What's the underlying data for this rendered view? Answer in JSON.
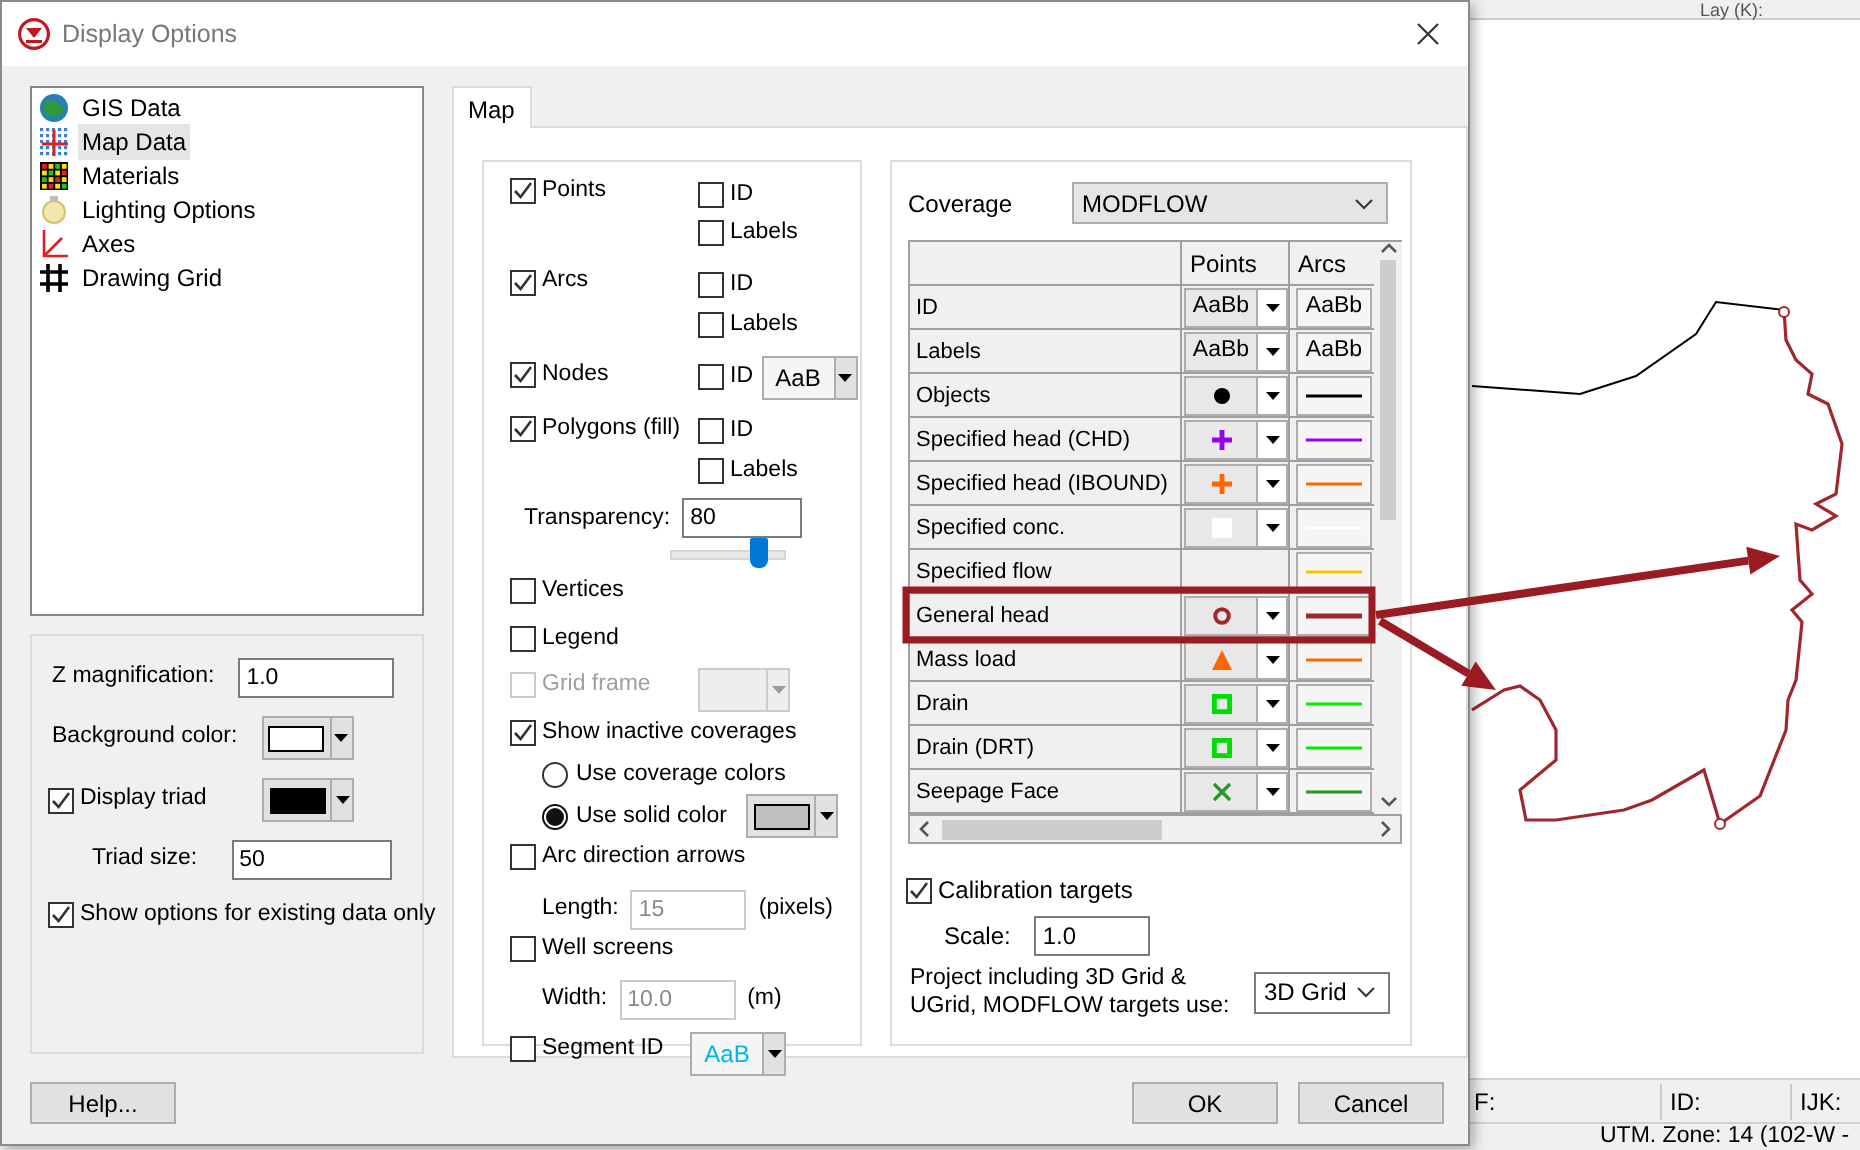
{
  "window": {
    "title": "Display Options"
  },
  "toolbar": {
    "layer_label": "Lay (K):"
  },
  "tree": [
    {
      "label": "GIS Data",
      "kind": "globe",
      "selected": false
    },
    {
      "label": "Map Data",
      "kind": "dots",
      "selected": true
    },
    {
      "label": "Materials",
      "kind": "cells",
      "selected": false
    },
    {
      "label": "Lighting Options",
      "kind": "bulb",
      "selected": false
    },
    {
      "label": "Axes",
      "kind": "axes",
      "selected": false
    },
    {
      "label": "Drawing Grid",
      "kind": "grid",
      "selected": false
    }
  ],
  "display": {
    "z_magnification": {
      "label": "Z magnification:",
      "value": "1.0"
    },
    "background_color": {
      "label": "Background color:",
      "color": "#ffffff"
    },
    "display_triad": {
      "label": "Display triad",
      "checked": true,
      "color": "#000000"
    },
    "triad_size": {
      "label": "Triad size:",
      "value": "50"
    },
    "existing_data_only": {
      "label": "Show options for existing data only",
      "checked": true
    }
  },
  "tabs": [
    {
      "label": "Map",
      "selected": true
    }
  ],
  "map_options": {
    "points": {
      "label": "Points",
      "checked": true,
      "id": {
        "label": "ID",
        "checked": false
      },
      "labels": {
        "label": "Labels",
        "checked": false
      }
    },
    "arcs": {
      "label": "Arcs",
      "checked": true,
      "id": {
        "label": "ID",
        "checked": false
      },
      "labels": {
        "label": "Labels",
        "checked": false
      }
    },
    "nodes": {
      "label": "Nodes",
      "checked": true,
      "id": {
        "label": "ID",
        "checked": false
      },
      "font_sample": "AaB",
      "color": "#000000"
    },
    "polygons": {
      "label": "Polygons (fill)",
      "checked": true,
      "id": {
        "label": "ID",
        "checked": false
      },
      "labels": {
        "label": "Labels",
        "checked": false
      }
    },
    "transparency": {
      "label": "Transparency:",
      "value": "80",
      "level": 0.76
    },
    "vertices": {
      "label": "Vertices",
      "checked": false
    },
    "legend": {
      "label": "Legend",
      "checked": false
    },
    "grid_frame": {
      "label": "Grid frame",
      "checked": false,
      "disabled": true
    },
    "show_inactive": {
      "label": "Show inactive coverages",
      "checked": true
    },
    "inactive_modes": [
      {
        "label": "Use coverage colors",
        "selected": false
      },
      {
        "label": "Use solid color",
        "selected": true,
        "color": "#c0c0c0"
      }
    ],
    "arc_direction_arrows": {
      "label": "Arc direction arrows",
      "checked": false
    },
    "length": {
      "label": "Length:",
      "value": "15",
      "unit": "(pixels)",
      "disabled": true
    },
    "well_screens": {
      "label": "Well screens",
      "checked": false
    },
    "width": {
      "label": "Width:",
      "value": "10.0",
      "unit": "(m)",
      "disabled": true
    },
    "segment_id": {
      "label": "Segment ID",
      "checked": false,
      "font_sample": "AaB",
      "color": "#00b4f0"
    }
  },
  "coverage": {
    "label": "Coverage",
    "value": "MODFLOW"
  },
  "symbol_table": {
    "columns": [
      "Points",
      "Arcs"
    ],
    "rows": [
      {
        "name": "ID",
        "highlighted": false,
        "point": {
          "kind": "text",
          "text": "AaBb"
        },
        "arc": {
          "kind": "text",
          "text": "AaBb"
        }
      },
      {
        "name": "Labels",
        "highlighted": false,
        "point": {
          "kind": "text",
          "text": "AaBb"
        },
        "arc": {
          "kind": "text",
          "text": "AaBb"
        }
      },
      {
        "name": "Objects",
        "highlighted": false,
        "point": {
          "kind": "dot",
          "color": "#000000"
        },
        "arc": {
          "kind": "line",
          "color": "#000000"
        }
      },
      {
        "name": "Specified head (CHD)",
        "highlighted": false,
        "point": {
          "kind": "plus",
          "color": "#9900ee"
        },
        "arc": {
          "kind": "line",
          "color": "#9900ff"
        }
      },
      {
        "name": "Specified head (IBOUND)",
        "highlighted": false,
        "point": {
          "kind": "plus",
          "color": "#ff6600"
        },
        "arc": {
          "kind": "line",
          "color": "#ff6600"
        }
      },
      {
        "name": "Specified conc.",
        "highlighted": false,
        "point": {
          "kind": "square",
          "color": "#ffffff"
        },
        "arc": {
          "kind": "line",
          "color": "#ffffff"
        }
      },
      {
        "name": "Specified flow",
        "highlighted": false,
        "point": {
          "kind": "none"
        },
        "arc": {
          "kind": "line",
          "color": "#ffc000"
        }
      },
      {
        "name": "General head",
        "highlighted": true,
        "point": {
          "kind": "circle",
          "color": "#a0282c"
        },
        "arc": {
          "kind": "line",
          "color": "#a0282c"
        }
      },
      {
        "name": "Mass load",
        "highlighted": false,
        "point": {
          "kind": "triangle",
          "color": "#ff6600"
        },
        "arc": {
          "kind": "line",
          "color": "#ff6600"
        }
      },
      {
        "name": "Drain",
        "highlighted": false,
        "point": {
          "kind": "square-outline",
          "color": "#00dd00"
        },
        "arc": {
          "kind": "line",
          "color": "#00ee00"
        }
      },
      {
        "name": "Drain (DRT)",
        "highlighted": false,
        "point": {
          "kind": "square-outline",
          "color": "#00dd00"
        },
        "arc": {
          "kind": "line",
          "color": "#00ee00"
        }
      },
      {
        "name": "Seepage Face",
        "highlighted": false,
        "point": {
          "kind": "cross",
          "color": "#229922"
        },
        "arc": {
          "kind": "line",
          "color": "#229922"
        }
      }
    ]
  },
  "calibration_targets": {
    "label": "Calibration targets",
    "checked": true
  },
  "scale": {
    "label": "Scale:",
    "value": "1.0"
  },
  "target_grid": {
    "label": "Project including 3D Grid & UGrid, MODFLOW targets use:",
    "value": "3D Grid"
  },
  "buttons": [
    {
      "label": "Help...",
      "kind": "help"
    },
    {
      "label": "OK",
      "kind": "ok"
    },
    {
      "label": "Cancel",
      "kind": "cancel"
    }
  ],
  "status_bar": {
    "fields": [
      "F:",
      "ID:",
      "IJK:"
    ],
    "projection": "UTM. Zone: 14 (102-W -"
  }
}
